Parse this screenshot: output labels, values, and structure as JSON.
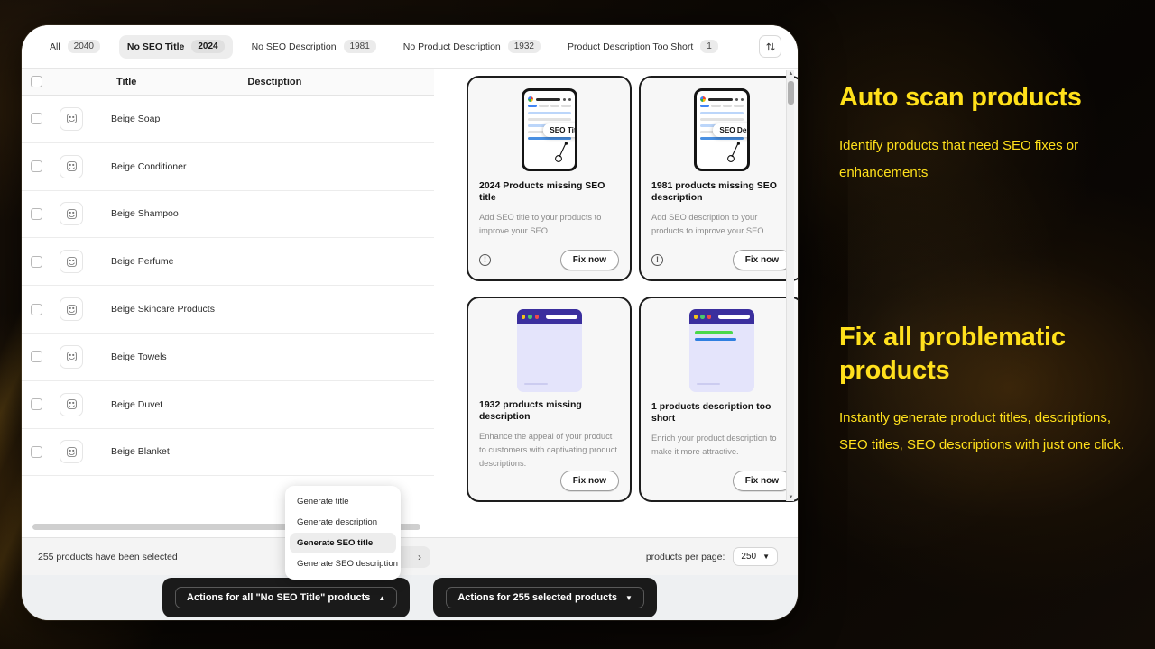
{
  "app": {
    "tabs": [
      {
        "label": "All",
        "count": "2040",
        "active": false
      },
      {
        "label": "No SEO Title",
        "count": "2024",
        "active": true
      },
      {
        "label": "No SEO Description",
        "count": "1981",
        "active": false
      },
      {
        "label": "No Product Description",
        "count": "1932",
        "active": false
      },
      {
        "label": "Product Description Too Short",
        "count": "1",
        "active": false
      }
    ],
    "sort_icon": "sort-arrows-icon",
    "table": {
      "columns": [
        "Title",
        "Desctiption"
      ],
      "rows": [
        {
          "title": "Beige Soap"
        },
        {
          "title": "Beige Conditioner"
        },
        {
          "title": "Beige Shampoo"
        },
        {
          "title": "Beige Perfume"
        },
        {
          "title": "Beige Skincare Products"
        },
        {
          "title": "Beige Towels"
        },
        {
          "title": "Beige Duvet"
        },
        {
          "title": "Beige Blanket"
        }
      ]
    },
    "cards": [
      {
        "heading": "2024 Products missing SEO title",
        "body": "Add SEO title to your products to improve your SEO",
        "button": "Fix now",
        "art": "phone-seo-title",
        "badge": "SEO Title",
        "has_info": true
      },
      {
        "heading": "1981 products missing SEO description",
        "body": "Add SEO description to your products to improve your SEO",
        "button": "Fix now",
        "art": "phone-seo-desc",
        "badge": "SEO Desc",
        "has_info": true
      },
      {
        "heading": "1932 products missing description",
        "body": "Enhance the appeal of your product to customers with captivating product descriptions.",
        "button": "Fix now",
        "art": "browser-plain",
        "badge": "",
        "has_info": false
      },
      {
        "heading": "1 products description too short",
        "body": "Enrich your product description to make it more attractive.",
        "button": "Fix now",
        "art": "browser-lines",
        "badge": "",
        "has_info": false
      }
    ],
    "footer": {
      "selection_status": "255 products have been selected",
      "prev_icon": "chevron-left-icon",
      "next_icon": "chevron-right-icon",
      "per_page_label": "products per page:",
      "per_page_value": "250"
    },
    "actions": {
      "all_button": "Actions for all \"No SEO Title\" products",
      "selected_button": "Actions for 255 selected products"
    },
    "menu": {
      "items": [
        {
          "label": "Generate title",
          "selected": false
        },
        {
          "label": "Generate description",
          "selected": false
        },
        {
          "label": "Generate SEO title",
          "selected": true
        },
        {
          "label": "Generate SEO description",
          "selected": false
        }
      ]
    }
  },
  "promo": {
    "accent_color": "#FFE01A",
    "block1": {
      "heading": "Auto scan products",
      "body": "Identify products that need SEO fixes or enhancements"
    },
    "block2": {
      "heading": "Fix all problematic products",
      "body": "Instantly generate product titles, descriptions, SEO titles, SEO descriptions with just one click."
    }
  }
}
